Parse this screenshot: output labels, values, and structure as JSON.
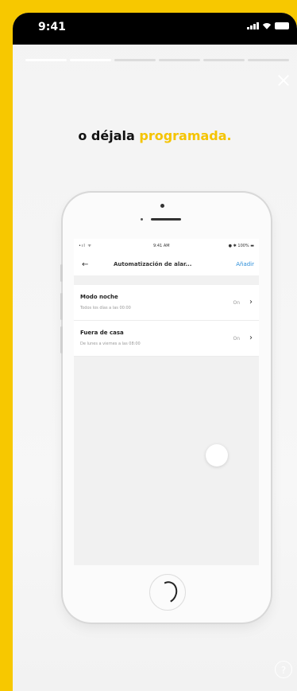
{
  "status_bar": {
    "time": "9:41"
  },
  "headline": {
    "prefix": "o déjala ",
    "accent": "programada."
  },
  "colors": {
    "accent": "#f5c400",
    "link": "#2e8fd9",
    "background": "#f7c800"
  },
  "stories": {
    "total": 6,
    "active": 2
  },
  "phone_mockup": {
    "status": {
      "left": "•ıl ᯤ",
      "time": "9:41 AM",
      "battery": "● ✱ 100% ▬"
    },
    "header": {
      "back_icon": "←",
      "title": "Automatización de alar...",
      "action": "Añadir"
    },
    "items": [
      {
        "title": "Modo noche",
        "subtitle": "Todos los días a las 00:00",
        "status": "On",
        "chevron": "›"
      },
      {
        "title": "Fuera de casa",
        "subtitle": "De lunes a viernes a las 08:00",
        "status": "On",
        "chevron": "›"
      }
    ]
  },
  "icons": {
    "close": "close-icon",
    "help": "help-icon",
    "help_glyph": "?"
  }
}
